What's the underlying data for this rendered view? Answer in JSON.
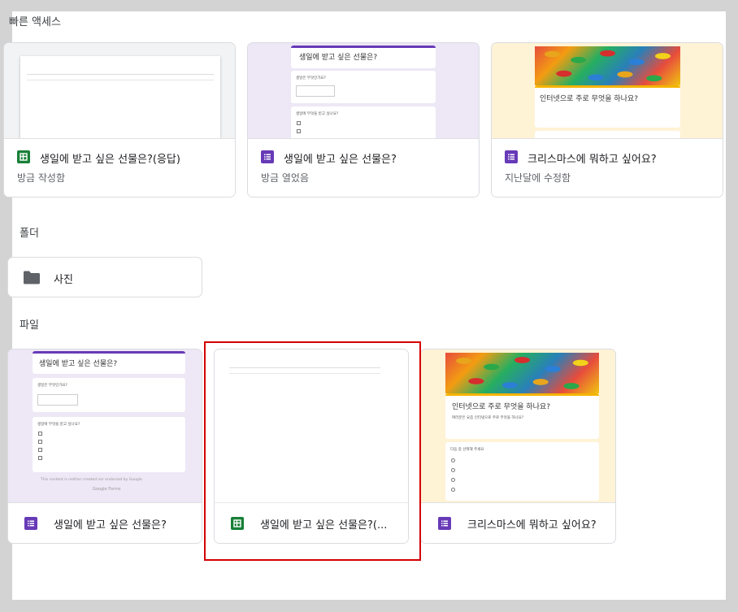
{
  "sections": {
    "quick_access": "빠른 액세스",
    "folders": "폴더",
    "files": "파일"
  },
  "quick_access": [
    {
      "title": "생일에 받고 싶은 선물은?(응답)",
      "subtitle": "방금 작성함",
      "type": "sheets"
    },
    {
      "title": "생일에 받고 싶은 선물은?",
      "subtitle": "방금 열었음",
      "type": "forms"
    },
    {
      "title": "크리스마스에 뭐하고 싶어요?",
      "subtitle": "지난달에 수정함",
      "type": "forms"
    }
  ],
  "folders": [
    {
      "name": "사진"
    }
  ],
  "files": [
    {
      "title": "생일에 받고 싶은 선물은?",
      "type": "forms"
    },
    {
      "title": "생일에 받고 싶은 선물은?(...",
      "type": "sheets"
    },
    {
      "title": "크리스마스에 뭐하고 싶어요?",
      "type": "forms"
    }
  ],
  "thumbnails": {
    "form_birthday_title": "생일에 받고 싶은 선물은?",
    "form_christmas_title": "인터넷으로 주로 무엇을 하나요?",
    "google_forms": "Google Forms"
  },
  "colors": {
    "sheets_green": "#188038",
    "forms_purple": "#673ab7",
    "selection_red": "#d50000"
  }
}
